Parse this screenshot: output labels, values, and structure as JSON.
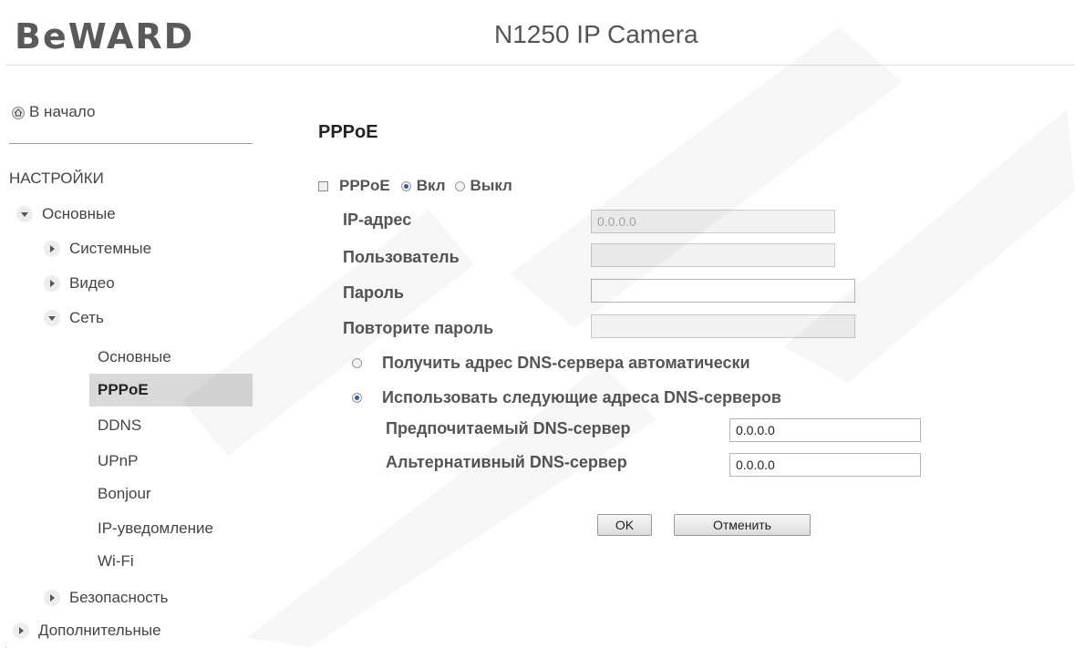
{
  "header": {
    "logo": "BeWARD",
    "title": "N1250 IP Camera"
  },
  "sidebar": {
    "home": "В начало",
    "section": "НАСТРОЙКИ",
    "basic": "Основные",
    "system": "Системные",
    "video": "Видео",
    "network": "Сеть",
    "net_items": [
      "Основные",
      "PPPoE",
      "DDNS",
      "UPnP",
      "Bonjour",
      "IP-уведомление",
      "Wi-Fi"
    ],
    "security": "Безопасность",
    "advanced": "Дополнительные",
    "active_item": "PPPoE"
  },
  "main": {
    "title": "PPPoE",
    "pppoe_label": "PPPoE",
    "on_label": "Вкл",
    "off_label": "Выкл",
    "ip_label": "IP-адрес",
    "ip_value": "0.0.0.0",
    "user_label": "Пользователь",
    "user_value": "",
    "password_label": "Пароль",
    "password_value": "",
    "repeat_label": "Повторите пароль",
    "repeat_value": "",
    "dns_auto": "Получить адрес DNS-сервера автоматически",
    "dns_manual": "Использовать следующие адреса DNS-серверов",
    "dns_pref_label": "Предпочитаемый DNS-сервер",
    "dns_pref_value": "0.0.0.0",
    "dns_alt_label": "Альтернативный DNS-сервер",
    "dns_alt_value": "0.0.0.0",
    "ok": "OK",
    "cancel": "Отменить"
  },
  "colors": {
    "accent_radio": "#3a5a9c",
    "active_bg": "#d9d9d9"
  }
}
